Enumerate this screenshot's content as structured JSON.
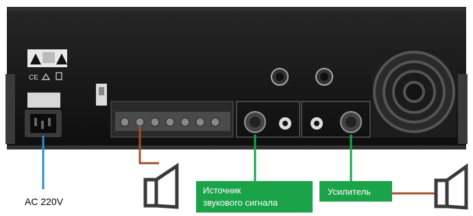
{
  "labels": {
    "ac_power": "AC 220V",
    "source_line1": "Источник",
    "source_line2": "звукового сигнала",
    "amplifier": "Усилитель"
  },
  "colors": {
    "panel": "#161616",
    "panel_edge": "#2b2b2b",
    "label_green": "#1ba34a",
    "power_wire": "#2a8fd3",
    "speaker_wire": "#a0522d",
    "signal_line": "#1ba34a",
    "speaker": "#3a3a3a"
  },
  "icons": [
    "warning-icon",
    "ce-mark-icon",
    "recycle-icon",
    "bin-icon",
    "speaker-icon",
    "fan-grille-icon"
  ]
}
